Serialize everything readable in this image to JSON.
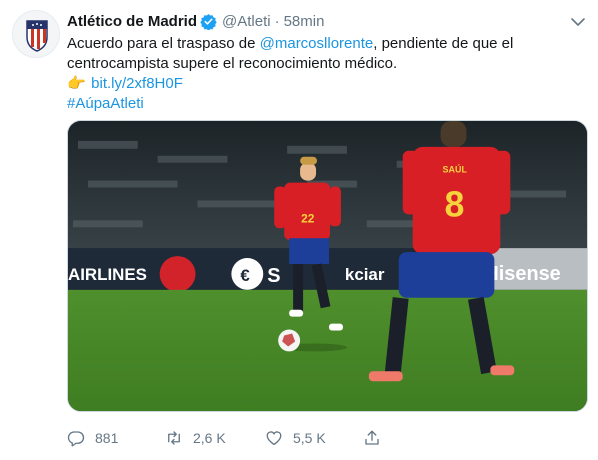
{
  "tweet": {
    "author": {
      "display_name": "Atlético de Madrid",
      "handle": "@Atleti",
      "verified": true
    },
    "separator": "·",
    "time": "58min",
    "text": {
      "line1_prefix": "Acuerdo para el traspaso de ",
      "mention": "@marcosllorente",
      "line1_suffix": ", pendiente de que el",
      "line2": "centrocampista supere el reconocimiento médico.",
      "emoji": "👉",
      "link": "bit.ly/2xf8H0F",
      "hashtag": "#AúpaAtleti"
    },
    "media": {
      "ad_boards": [
        "AIRLINES",
        "€",
        "S",
        "kciar",
        "Hisense"
      ],
      "player_front_number": "22",
      "player_back_name": "SAÚL",
      "player_back_number": "8"
    },
    "actions": {
      "replies": "881",
      "retweets": "2,6 K",
      "likes": "5,5 K"
    },
    "icons": {
      "verified": "verified-badge-icon",
      "caret": "chevron-down-icon",
      "reply": "reply-icon",
      "retweet": "retweet-icon",
      "like": "heart-icon",
      "share": "share-icon"
    },
    "colors": {
      "link": "#1b95e0",
      "muted": "#657786",
      "verified": "#1da1f2",
      "text": "#14171a"
    }
  }
}
